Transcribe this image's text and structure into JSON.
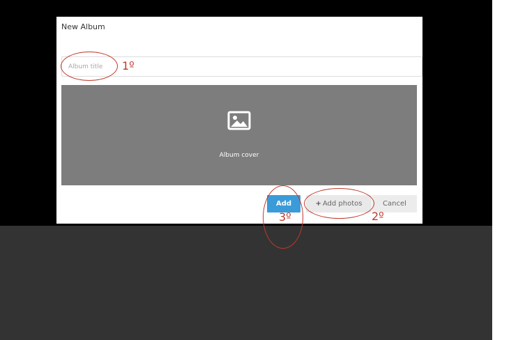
{
  "dialog": {
    "title": "New Album",
    "album_title_placeholder": "Album title",
    "cover": {
      "icon": "image-icon",
      "label": "Album cover"
    },
    "buttons": {
      "add_label": "Add",
      "add_photos_icon": "plus-icon",
      "add_photos_label": "Add photos",
      "cancel_label": "Cancel"
    }
  },
  "annotations": {
    "step_1": "1º",
    "step_2": "2º",
    "step_3": "3º",
    "color": "#c0392b"
  },
  "colors": {
    "backdrop": "#000000",
    "backdrop_lower": "#333333",
    "cover_background": "#7d7d7d",
    "primary_button": "#3b9bd9"
  }
}
